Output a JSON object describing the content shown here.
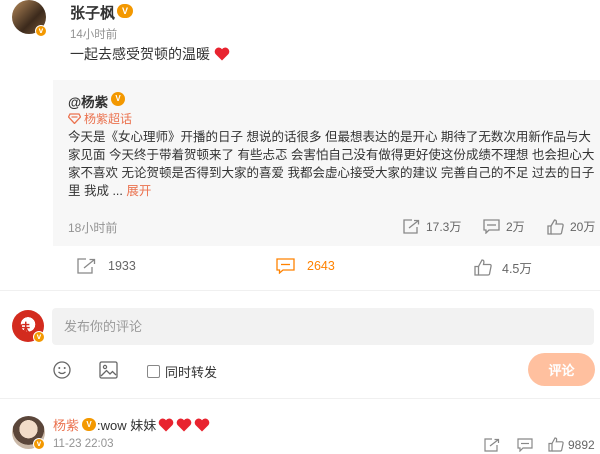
{
  "post": {
    "author": "张子枫",
    "time": "14小时前",
    "text": "一起去感受贺顿的温暖"
  },
  "repost": {
    "author": "@杨紫",
    "topic": "杨紫超话",
    "text": "今天是《女心理师》开播的日子 想说的话很多 但最想表达的是开心 期待了无数次用新作品与大家见面 今天终于带着贺顿来了 有些忐忑 会害怕自己没有做得更好使这份成绩不理想 也会担心大家不喜欢 无论贺顿是否得到大家的喜爱 我都会虚心接受大家的建议 完善自己的不足 过去的日子里 我成 ...",
    "expand": "展开",
    "time": "18小时前",
    "reposts": "17.3万",
    "comments": "2万",
    "likes": "20万"
  },
  "actions": {
    "reposts": "1933",
    "comments": "2643",
    "likes": "4.5万"
  },
  "composer": {
    "placeholder": "发布你的评论",
    "repost_checkbox_label": "同时转发",
    "submit_label": "评论"
  },
  "comment": {
    "author": "杨紫",
    "text": ":wow 妹妹",
    "time": "11-23 22:03",
    "likes": "9892"
  },
  "colors": {
    "orange": "#ff8200",
    "heart": "#e8232f",
    "link": "#eb7350",
    "vip": "#f39800"
  }
}
